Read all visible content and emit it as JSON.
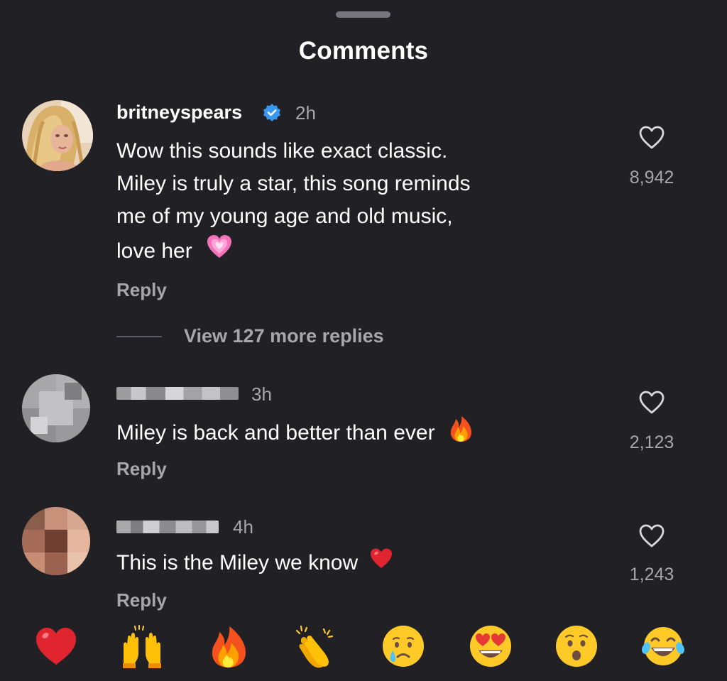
{
  "header": {
    "title": "Comments"
  },
  "comments": [
    {
      "username": "britneyspears",
      "verified": true,
      "time": "2h",
      "lines": [
        "Wow this sounds like exact classic.",
        "Miley is truly a star, this song reminds",
        "me of my young age and old music,",
        "love her"
      ],
      "trailing_emoji": "pink-heart-emoji",
      "reply_label": "Reply",
      "likes": "8,942",
      "view_replies": "View 127 more replies"
    },
    {
      "username": "",
      "time": "3h",
      "lines": [
        "Miley is back and better than ever"
      ],
      "trailing_emoji": "fire-emoji",
      "reply_label": "Reply",
      "likes": "2,123"
    },
    {
      "username": "",
      "time": "4h",
      "lines": [
        "This is the Miley we know"
      ],
      "trailing_emoji": "red-heart-emoji",
      "reply_label": "Reply",
      "likes": "1,243"
    }
  ],
  "reaction_bar": [
    "red-heart-emoji",
    "raising-hands-emoji",
    "fire-emoji",
    "clapping-hands-emoji",
    "crying-face-emoji",
    "heart-eyes-emoji",
    "surprised-face-emoji",
    "tears-of-joy-emoji"
  ],
  "colors": {
    "background": "#212125",
    "secondary_text": "#a6a6ab",
    "verified_badge": "#3897f0"
  }
}
